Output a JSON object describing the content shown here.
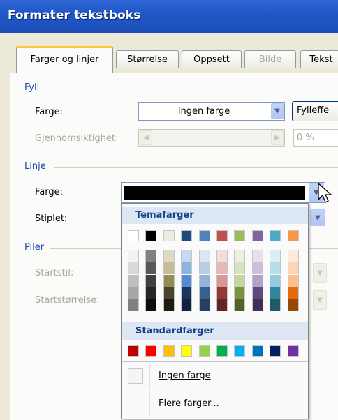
{
  "window": {
    "title": "Formater tekstboks"
  },
  "tabs": [
    {
      "label": "Farger og linjer",
      "active": true
    },
    {
      "label": "Størrelse"
    },
    {
      "label": "Oppsett"
    },
    {
      "label": "Bilde",
      "disabled": true
    },
    {
      "label": "Tekst"
    }
  ],
  "fill": {
    "group_label": "Fyll",
    "color_label": "Farge:",
    "color_value": "Ingen farge",
    "effects_button": "Fylleffe",
    "transparency_label": "Gjennomsiktighet:",
    "transparency_value": "0 %"
  },
  "line": {
    "group_label": "Linje",
    "color_label": "Farge:",
    "color_value": "#000000",
    "dashed_label": "Stiplet:"
  },
  "arrows": {
    "group_label": "Piler",
    "start_style_label": "Startstil:",
    "start_size_label": "Startstørrelse:"
  },
  "color_popup": {
    "theme_header": "Temafarger",
    "standard_header": "Standardfarger",
    "no_color": "Ingen farge",
    "more_colors": "Flere farger...",
    "theme_colors": [
      [
        "#ffffff",
        "#f2f2f2",
        "#d9d9d9",
        "#bfbfbf",
        "#a6a6a6",
        "#808080"
      ],
      [
        "#000000",
        "#7f7f7f",
        "#595959",
        "#404040",
        "#262626",
        "#0d0d0d"
      ],
      [
        "#eeece1",
        "#ddd9c3",
        "#c4bd97",
        "#948a54",
        "#4a452a",
        "#1e1c11"
      ],
      [
        "#1f497d",
        "#c6d9f1",
        "#8db3e2",
        "#548dd4",
        "#17365d",
        "#0f243e"
      ],
      [
        "#4f81bd",
        "#dce6f2",
        "#b9cde5",
        "#95b3d7",
        "#366092",
        "#254061"
      ],
      [
        "#c0504d",
        "#f2dcdb",
        "#e6b9b8",
        "#d99694",
        "#953735",
        "#632523"
      ],
      [
        "#9bbb59",
        "#ebf1de",
        "#d7e4bd",
        "#c3d69b",
        "#77933c",
        "#4f6228"
      ],
      [
        "#8064a2",
        "#e6e0ec",
        "#ccc1da",
        "#b3a2c7",
        "#604a7b",
        "#403152"
      ],
      [
        "#4bacc6",
        "#dbeef4",
        "#b7dee8",
        "#93cddd",
        "#31859c",
        "#215968"
      ],
      [
        "#f79646",
        "#fdeada",
        "#fcd5b5",
        "#fac090",
        "#e46c0a",
        "#984807"
      ]
    ],
    "standard_colors": [
      "#c00000",
      "#ff0000",
      "#ffc000",
      "#ffff00",
      "#92d050",
      "#00b050",
      "#00b0f0",
      "#0070c0",
      "#002060",
      "#7030a0"
    ]
  }
}
